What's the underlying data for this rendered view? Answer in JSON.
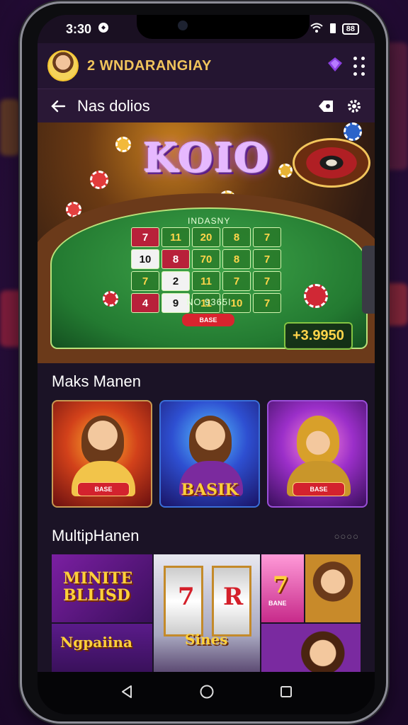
{
  "status_bar": {
    "time": "3:30",
    "battery": "88"
  },
  "header": {
    "app_name": "2 WNDARANGIAY"
  },
  "subheader": {
    "title": "Nas dolios"
  },
  "hero": {
    "title": "KOIO",
    "felt_label": "INDASNY",
    "felt_sub": "NO 9365I",
    "felt_button": "BASE",
    "jackpot": "+3.9950",
    "board": [
      "7",
      "11",
      "20",
      "8",
      "7",
      "10",
      "8",
      "70",
      "8",
      "7",
      "7",
      "2",
      "11",
      "7",
      "7",
      "4",
      "9",
      "11",
      "10",
      "7"
    ]
  },
  "featured": {
    "title": "Maks Manen",
    "cards": [
      {
        "button": "BASE"
      },
      {
        "logo": "BASIK"
      },
      {
        "button": "BASE"
      }
    ]
  },
  "multiplayer": {
    "title": "MultipHanen",
    "more": "○○○○",
    "tiles": {
      "banner_top": "MINITE BLLISD",
      "banner_bottom": "Ngpaiina",
      "reel_1": "7",
      "reel_2": "R",
      "reel_label": "Sines",
      "tile_7": "7",
      "tile_label": "BANE"
    }
  },
  "colors": {
    "accent_gold": "#f1c45c",
    "felt_green": "#237a31",
    "brand_purple": "#6b2c91"
  }
}
